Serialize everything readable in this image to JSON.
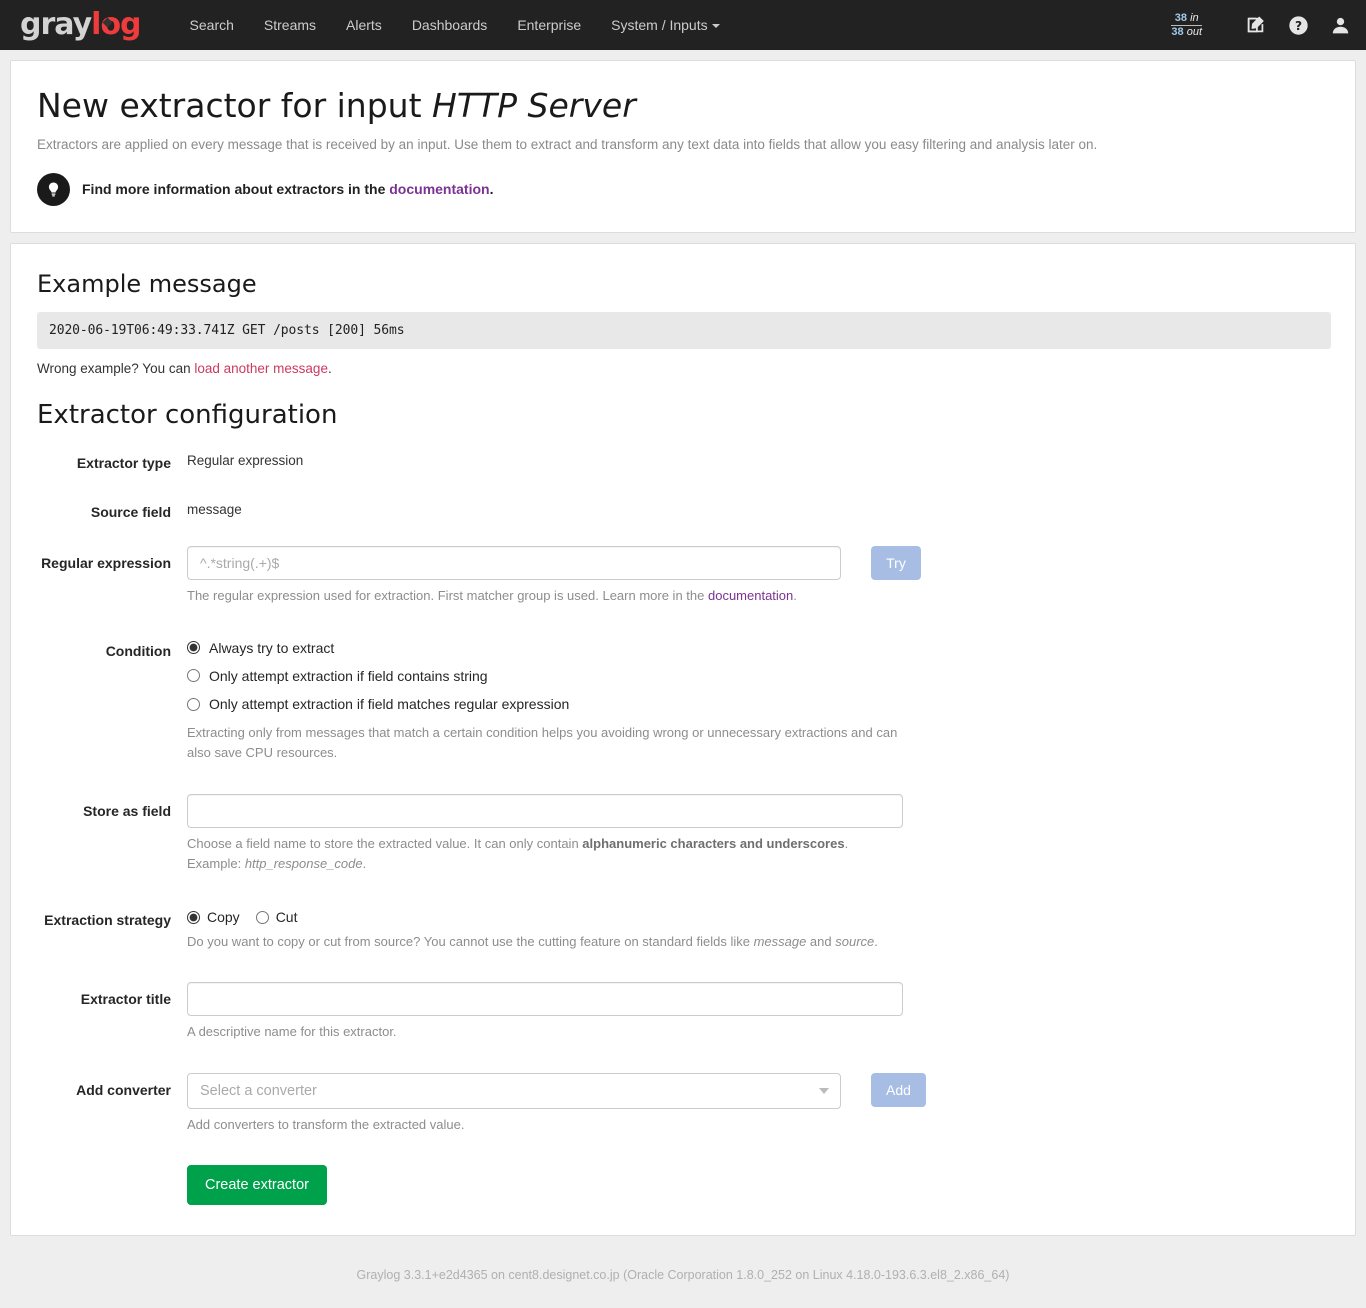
{
  "navbar": {
    "brand": {
      "part1": "gray",
      "part2": "log"
    },
    "links": [
      {
        "label": "Search",
        "name": "nav-link-search",
        "caret": false
      },
      {
        "label": "Streams",
        "name": "nav-link-streams",
        "caret": false
      },
      {
        "label": "Alerts",
        "name": "nav-link-alerts",
        "caret": false
      },
      {
        "label": "Dashboards",
        "name": "nav-link-dashboards",
        "caret": false
      },
      {
        "label": "Enterprise",
        "name": "nav-link-enterprise",
        "caret": false
      },
      {
        "label": "System / Inputs",
        "name": "nav-link-system-inputs",
        "caret": true
      }
    ],
    "throughput": {
      "in_value": "38",
      "in_unit": "in",
      "out_value": "38",
      "out_unit": "out"
    },
    "icons": [
      {
        "name": "edit-pencil-icon"
      },
      {
        "name": "help-question-icon"
      },
      {
        "name": "user-account-icon"
      }
    ]
  },
  "header": {
    "title_prefix": "New extractor for input ",
    "title_emphasis": "HTTP Server",
    "description": "Extractors are applied on every message that is received by an input. Use them to extract and transform any text data into fields that allow you easy filtering and analysis later on.",
    "hint_prefix": "Find more information about extractors in the ",
    "hint_link": "documentation",
    "hint_suffix": "."
  },
  "example": {
    "section_title": "Example message",
    "message": "2020-06-19T06:49:33.741Z GET /posts [200] 56ms",
    "wrong_prefix": "Wrong example? You can ",
    "wrong_link": "load another message",
    "wrong_suffix": "."
  },
  "config": {
    "section_title": "Extractor configuration",
    "extractor_type": {
      "label": "Extractor type",
      "value": "Regular expression"
    },
    "source_field": {
      "label": "Source field",
      "value": "message"
    },
    "regular_expression": {
      "label": "Regular expression",
      "value": "",
      "placeholder": "^.*string(.+)$",
      "try_button": "Try",
      "help_prefix": "The regular expression used for extraction. First matcher group is used. Learn more in the ",
      "help_link": "documentation",
      "help_suffix": "."
    },
    "condition": {
      "label": "Condition",
      "options": [
        {
          "label": "Always try to extract",
          "selected": true
        },
        {
          "label": "Only attempt extraction if field contains string",
          "selected": false
        },
        {
          "label": "Only attempt extraction if field matches regular expression",
          "selected": false
        }
      ],
      "help": "Extracting only from messages that match a certain condition helps you avoiding wrong or unnecessary extractions and can also save CPU resources."
    },
    "store_as_field": {
      "label": "Store as field",
      "value": "",
      "placeholder": "",
      "help_part1": "Choose a field name to store the extracted value. It can only contain ",
      "help_bold": "alphanumeric characters and underscores",
      "help_part2": ". Example: ",
      "help_italic": "http_response_code",
      "help_part3": "."
    },
    "extraction_strategy": {
      "label": "Extraction strategy",
      "options": [
        {
          "label": "Copy",
          "selected": true
        },
        {
          "label": "Cut",
          "selected": false
        }
      ],
      "help_part1": "Do you want to copy or cut from source? You cannot use the cutting feature on standard fields like ",
      "help_italic1": "message",
      "help_part2": " and ",
      "help_italic2": "source",
      "help_part3": "."
    },
    "extractor_title": {
      "label": "Extractor title",
      "value": "",
      "placeholder": "",
      "help": "A descriptive name for this extractor."
    },
    "add_converter": {
      "label": "Add converter",
      "selected_value": "Select a converter",
      "add_button": "Add",
      "help": "Add converters to transform the extracted value."
    },
    "submit_button": "Create extractor"
  },
  "footer": {
    "text": "Graylog 3.3.1+e2d4365 on cent8.designet.co.jp (Oracle Corporation 1.8.0_252 on Linux 4.18.0-193.6.3.el8_2.x86_64)"
  },
  "colors": {
    "navbar_bg": "#222222",
    "brand_red": "#ee3b3b",
    "success_green": "#00a14b",
    "muted_blue": "#a7bde4",
    "doc_link_purple": "#7b3294",
    "msg_link_crimson": "#cb3a60"
  }
}
